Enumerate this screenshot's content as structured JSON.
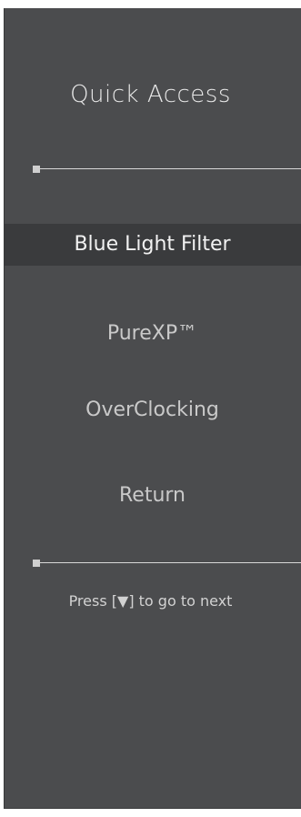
{
  "panel": {
    "title": "Quick Access"
  },
  "menu": {
    "items": [
      {
        "label": "Blue Light Filter",
        "selected": true
      },
      {
        "label": "PureXP™",
        "selected": false
      },
      {
        "label": "OverClocking",
        "selected": false
      },
      {
        "label": "Return",
        "selected": false
      }
    ]
  },
  "hint": {
    "prefix": "Press",
    "key": "[▼]",
    "suffix": "to go to next"
  },
  "colors": {
    "panel_background": "#4b4c4e",
    "selected_background": "#3a3b3d",
    "text": "#e8e8e8"
  }
}
